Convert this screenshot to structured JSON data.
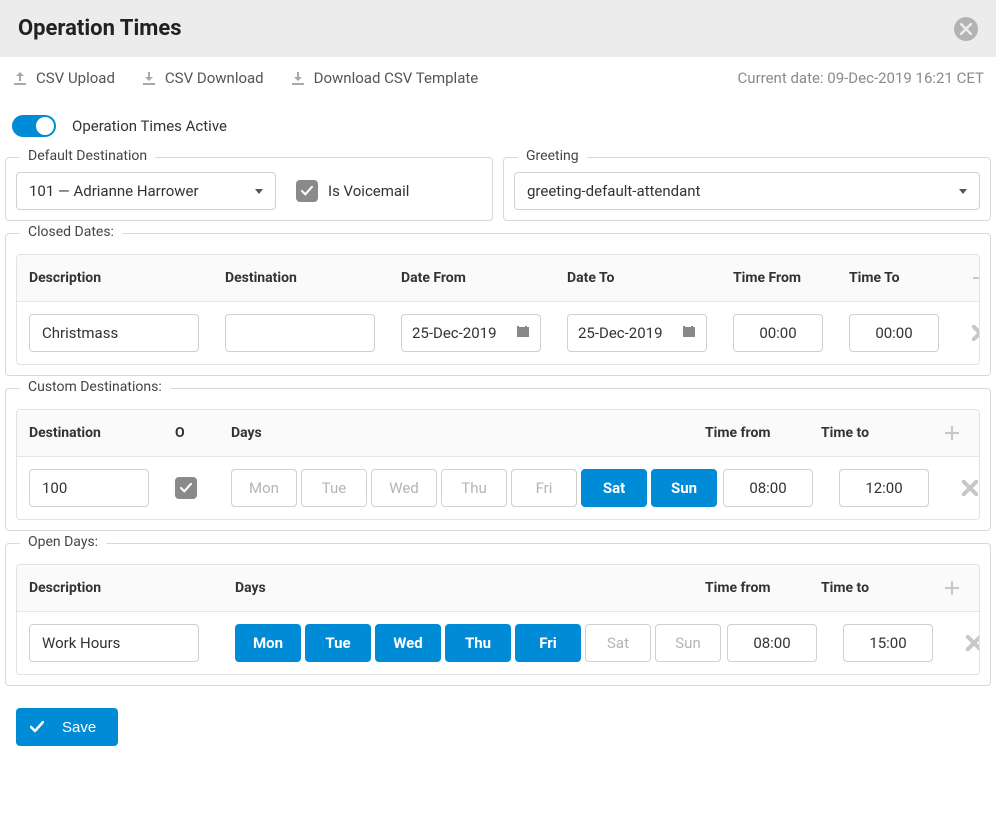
{
  "header": {
    "title": "Operation Times"
  },
  "csv": {
    "upload": "CSV Upload",
    "download": "CSV Download",
    "template": "Download CSV Template",
    "current_date": "Current date: 09-Dec-2019 16:21 CET"
  },
  "toggle": {
    "label": "Operation Times Active",
    "on": true
  },
  "defaultDestination": {
    "legend": "Default Destination",
    "value": "101  —  Adrianne Harrower",
    "isVoicemailLabel": "Is Voicemail",
    "isVoicemailChecked": true
  },
  "greeting": {
    "legend": "Greeting",
    "value": "greeting-default-attendant"
  },
  "closed": {
    "legend": "Closed Dates:",
    "headers": {
      "description": "Description",
      "destination": "Destination",
      "dateFrom": "Date From",
      "dateTo": "Date To",
      "timeFrom": "Time From",
      "timeTo": "Time To"
    },
    "rows": [
      {
        "description": "Christmass",
        "destination": "",
        "dateFrom": "25-Dec-2019",
        "dateTo": "25-Dec-2019",
        "timeFrom": "00:00",
        "timeTo": "00:00"
      }
    ]
  },
  "custom": {
    "legend": "Custom Destinations:",
    "headers": {
      "destination": "Destination",
      "o": "O",
      "days": "Days",
      "timeFrom": "Time from",
      "timeTo": "Time to"
    },
    "rows": [
      {
        "destination": "100",
        "oChecked": true,
        "days": [
          {
            "label": "Mon",
            "selected": false
          },
          {
            "label": "Tue",
            "selected": false
          },
          {
            "label": "Wed",
            "selected": false
          },
          {
            "label": "Thu",
            "selected": false
          },
          {
            "label": "Fri",
            "selected": false
          },
          {
            "label": "Sat",
            "selected": true
          },
          {
            "label": "Sun",
            "selected": true
          }
        ],
        "timeFrom": "08:00",
        "timeTo": "12:00"
      }
    ]
  },
  "open": {
    "legend": "Open Days:",
    "headers": {
      "description": "Description",
      "days": "Days",
      "timeFrom": "Time from",
      "timeTo": "Time to"
    },
    "rows": [
      {
        "description": "Work Hours",
        "days": [
          {
            "label": "Mon",
            "selected": true
          },
          {
            "label": "Tue",
            "selected": true
          },
          {
            "label": "Wed",
            "selected": true
          },
          {
            "label": "Thu",
            "selected": true
          },
          {
            "label": "Fri",
            "selected": true
          },
          {
            "label": "Sat",
            "selected": false
          },
          {
            "label": "Sun",
            "selected": false
          }
        ],
        "timeFrom": "08:00",
        "timeTo": "15:00"
      }
    ]
  },
  "save": {
    "label": "Save"
  }
}
